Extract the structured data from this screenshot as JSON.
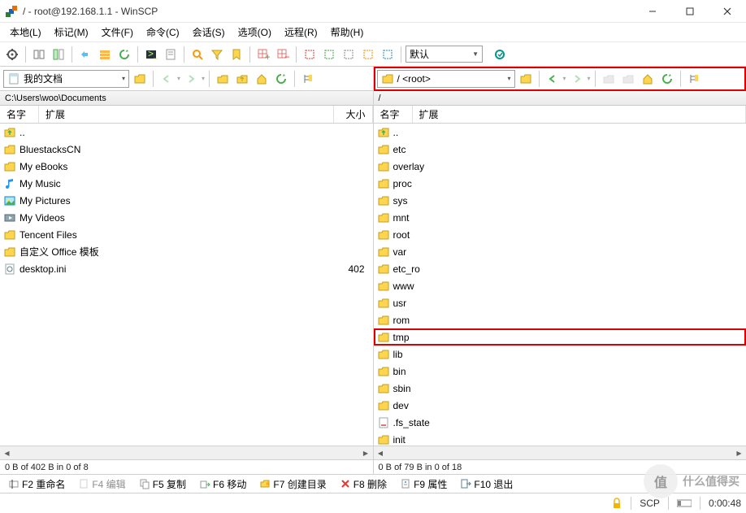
{
  "window": {
    "title": "/ - root@192.168.1.1 - WinSCP"
  },
  "menu": [
    "本地(L)",
    "标记(M)",
    "文件(F)",
    "命令(C)",
    "会话(S)",
    "选项(O)",
    "远程(R)",
    "帮助(H)"
  ],
  "mainToolbar": {
    "preset": "默认"
  },
  "left": {
    "combo": "我的文档",
    "path": "C:\\Users\\woo\\Documents",
    "headers": {
      "name": "名字",
      "ext": "扩展",
      "size": "大小"
    },
    "items": [
      {
        "icon": "up",
        "name": "..",
        "size": ""
      },
      {
        "icon": "folder",
        "name": "BluestacksCN",
        "size": ""
      },
      {
        "icon": "folder",
        "name": "My eBooks",
        "size": ""
      },
      {
        "icon": "music",
        "name": "My Music",
        "size": ""
      },
      {
        "icon": "pictures",
        "name": "My Pictures",
        "size": ""
      },
      {
        "icon": "videos",
        "name": "My Videos",
        "size": ""
      },
      {
        "icon": "folder",
        "name": "Tencent Files",
        "size": ""
      },
      {
        "icon": "folder",
        "name": "自定义 Office 模板",
        "size": ""
      },
      {
        "icon": "ini",
        "name": "desktop.ini",
        "size": "402"
      }
    ],
    "status": "0 B of 402 B in 0 of 8"
  },
  "right": {
    "combo": "/ <root>",
    "path": "/",
    "headers": {
      "name": "名字",
      "ext": "扩展"
    },
    "items": [
      {
        "icon": "up",
        "name": ".."
      },
      {
        "icon": "folder",
        "name": "etc"
      },
      {
        "icon": "folder",
        "name": "overlay"
      },
      {
        "icon": "folder",
        "name": "proc"
      },
      {
        "icon": "folder",
        "name": "sys"
      },
      {
        "icon": "folder",
        "name": "mnt"
      },
      {
        "icon": "folder",
        "name": "root"
      },
      {
        "icon": "folder-sys",
        "name": "var"
      },
      {
        "icon": "folder",
        "name": "etc_ro"
      },
      {
        "icon": "folder",
        "name": "www"
      },
      {
        "icon": "folder",
        "name": "usr"
      },
      {
        "icon": "folder",
        "name": "rom"
      },
      {
        "icon": "folder",
        "name": "tmp",
        "hl": true
      },
      {
        "icon": "folder",
        "name": "lib"
      },
      {
        "icon": "folder",
        "name": "bin"
      },
      {
        "icon": "folder",
        "name": "sbin"
      },
      {
        "icon": "folder",
        "name": "dev"
      },
      {
        "icon": "file",
        "name": ".fs_state"
      },
      {
        "icon": "folder",
        "name": "init"
      }
    ],
    "status": "0 B of 79 B in 0 of 18"
  },
  "fnbar": [
    {
      "key": "F2",
      "label": "重命名",
      "icon": "rename"
    },
    {
      "key": "F4",
      "label": "编辑",
      "icon": "edit",
      "disabled": true
    },
    {
      "key": "F5",
      "label": "复制",
      "icon": "copy"
    },
    {
      "key": "F6",
      "label": "移动",
      "icon": "move"
    },
    {
      "key": "F7",
      "label": "创建目录",
      "icon": "mkdir"
    },
    {
      "key": "F8",
      "label": "删除",
      "icon": "delete"
    },
    {
      "key": "F9",
      "label": "属性",
      "icon": "props"
    },
    {
      "key": "F10",
      "label": "退出",
      "icon": "exit"
    }
  ],
  "status": {
    "proto": "SCP",
    "time": "0:00:48"
  },
  "watermark": "什么值得买"
}
